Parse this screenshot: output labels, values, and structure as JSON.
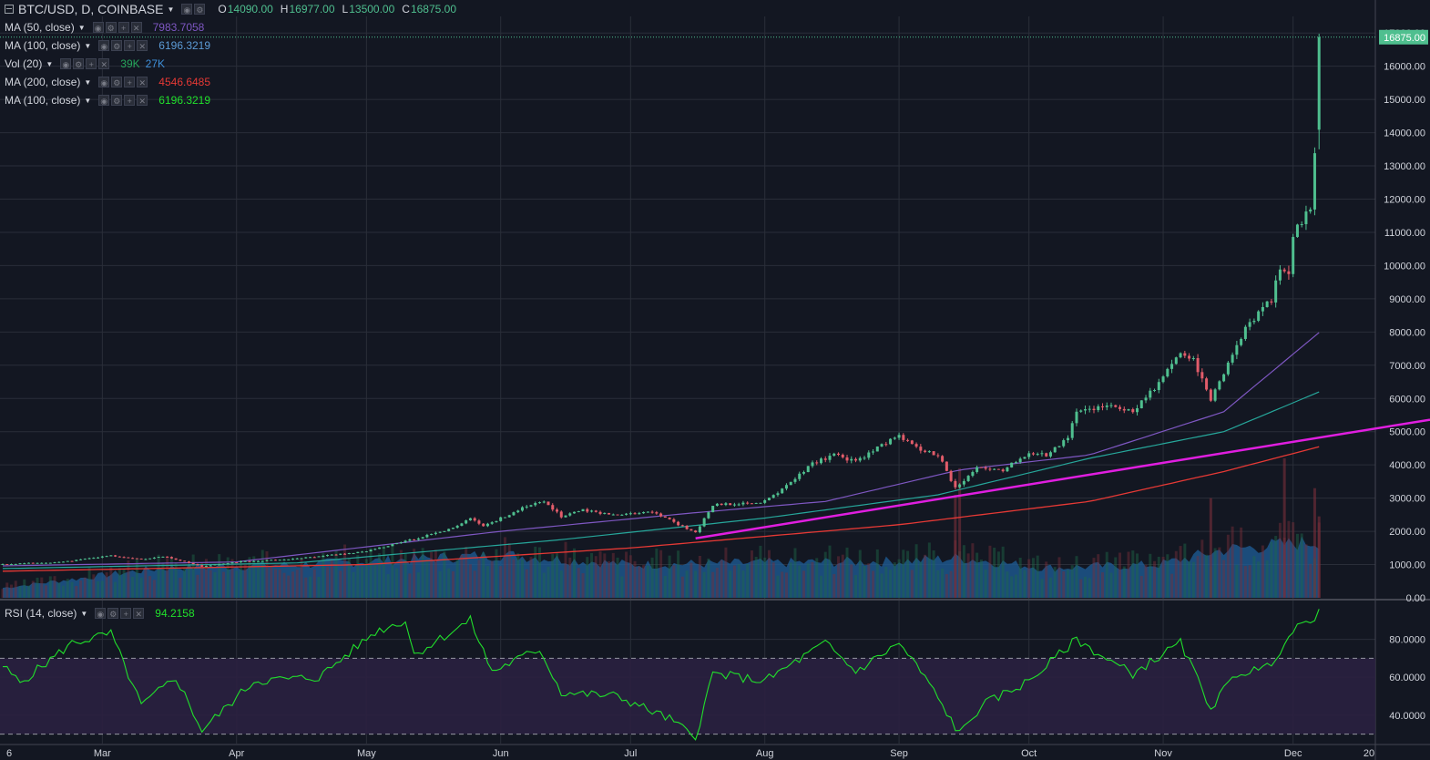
{
  "header": {
    "symbol": "BTC/USD, D, COINBASE",
    "open_label": "O",
    "open": "14090.00",
    "high_label": "H",
    "high": "16977.00",
    "low_label": "L",
    "low": "13500.00",
    "close_label": "C",
    "close": "16875.00"
  },
  "indicators": [
    {
      "label": "MA (50, close)",
      "values": [
        "7983.7058"
      ],
      "colors": [
        "#7e57c2"
      ]
    },
    {
      "label": "MA (100, close)",
      "values": [
        "6196.3219"
      ],
      "colors": [
        "#5c9bd6"
      ]
    },
    {
      "label": "Vol (20)",
      "values": [
        "39K",
        "27K"
      ],
      "colors": [
        "#26a65b",
        "#3d8ed8"
      ]
    },
    {
      "label": "MA (200, close)",
      "values": [
        "4546.6485"
      ],
      "colors": [
        "#e53935"
      ]
    },
    {
      "label": "MA (100, close)",
      "values": [
        "6196.3219"
      ],
      "colors": [
        "#21e02b"
      ]
    }
  ],
  "rsi_header": {
    "label": "RSI (14, close)",
    "value": "94.2158",
    "color": "#21e02b"
  },
  "price_axis": {
    "ticks": [
      "16000.00",
      "15000.00",
      "14000.00",
      "13000.00",
      "12000.00",
      "11000.00",
      "10000.00",
      "9000.00",
      "8000.00",
      "7000.00",
      "6000.00",
      "5000.00",
      "4000.00",
      "3000.00",
      "2000.00",
      "1000.00",
      "0.00",
      "17000.00"
    ],
    "last_price_label": "16875.00"
  },
  "rsi_axis": {
    "ticks": [
      "80.0000",
      "60.0000",
      "40.0000"
    ]
  },
  "time_axis": {
    "ticks": [
      "6",
      "Mar",
      "Apr",
      "May",
      "Jun",
      "Jul",
      "Aug",
      "Sep",
      "Oct",
      "Nov",
      "Dec",
      "20"
    ]
  },
  "colors": {
    "background": "#131722",
    "grid": "#2a2e39",
    "up": "#4fbf8f",
    "down": "#e25c6a",
    "ma50": "#7e57c2",
    "ma100": "#26a69a",
    "ma200": "#e53935",
    "trendline": "#e01ee0",
    "volume": "#1f5f99",
    "rsi_line": "#21e02b",
    "rsi_band": "#2a2040",
    "lastprice": "#4fbf8f"
  },
  "chart_data": {
    "type": "candlestick",
    "title": "BTC/USD, D, COINBASE",
    "ylim": [
      0,
      17500
    ],
    "rsi_ylim": [
      25,
      100
    ],
    "rsi_levels": [
      70,
      30
    ],
    "x_range": [
      "2017-02-06",
      "2017-12-20"
    ],
    "price_keypoints": [
      [
        "2017-02-06",
        1010
      ],
      [
        "2017-02-20",
        1080
      ],
      [
        "2017-03-03",
        1270
      ],
      [
        "2017-03-10",
        1150
      ],
      [
        "2017-03-15",
        1250
      ],
      [
        "2017-03-24",
        940
      ],
      [
        "2017-04-01",
        1080
      ],
      [
        "2017-04-15",
        1180
      ],
      [
        "2017-05-01",
        1400
      ],
      [
        "2017-05-10",
        1700
      ],
      [
        "2017-05-20",
        2050
      ],
      [
        "2017-05-25",
        2400
      ],
      [
        "2017-05-28",
        2150
      ],
      [
        "2017-06-06",
        2700
      ],
      [
        "2017-06-11",
        2900
      ],
      [
        "2017-06-15",
        2450
      ],
      [
        "2017-06-20",
        2650
      ],
      [
        "2017-06-26",
        2500
      ],
      [
        "2017-07-06",
        2600
      ],
      [
        "2017-07-16",
        1950
      ],
      [
        "2017-07-20",
        2800
      ],
      [
        "2017-07-31",
        2850
      ],
      [
        "2017-08-05",
        3250
      ],
      [
        "2017-08-12",
        4050
      ],
      [
        "2017-08-17",
        4300
      ],
      [
        "2017-08-22",
        4100
      ],
      [
        "2017-09-01",
        4900
      ],
      [
        "2017-09-05",
        4500
      ],
      [
        "2017-09-10",
        4300
      ],
      [
        "2017-09-14",
        3300
      ],
      [
        "2017-09-19",
        3900
      ],
      [
        "2017-09-25",
        3850
      ],
      [
        "2017-10-01",
        4350
      ],
      [
        "2017-10-05",
        4300
      ],
      [
        "2017-10-10",
        4800
      ],
      [
        "2017-10-12",
        5600
      ],
      [
        "2017-10-20",
        5800
      ],
      [
        "2017-10-25",
        5600
      ],
      [
        "2017-10-31",
        6450
      ],
      [
        "2017-11-05",
        7400
      ],
      [
        "2017-11-08",
        7150
      ],
      [
        "2017-11-12",
        5900
      ],
      [
        "2017-11-15",
        6800
      ],
      [
        "2017-11-20",
        8100
      ],
      [
        "2017-11-26",
        9000
      ],
      [
        "2017-11-28",
        9900
      ],
      [
        "2017-11-30",
        9700
      ],
      [
        "2017-12-01",
        10900
      ],
      [
        "2017-12-05",
        11700
      ],
      [
        "2017-12-06",
        13500
      ],
      [
        "2017-12-07",
        16875
      ]
    ],
    "ma50_keypoints": [
      [
        "2017-02-06",
        960
      ],
      [
        "2017-04-01",
        1080
      ],
      [
        "2017-06-01",
        2000
      ],
      [
        "2017-07-15",
        2550
      ],
      [
        "2017-08-15",
        2900
      ],
      [
        "2017-09-15",
        3850
      ],
      [
        "2017-10-15",
        4300
      ],
      [
        "2017-11-15",
        5600
      ],
      [
        "2017-12-07",
        7984
      ]
    ],
    "ma100_keypoints": [
      [
        "2017-02-06",
        880
      ],
      [
        "2017-04-15",
        1050
      ],
      [
        "2017-06-15",
        1750
      ],
      [
        "2017-08-01",
        2400
      ],
      [
        "2017-09-10",
        3100
      ],
      [
        "2017-10-15",
        4200
      ],
      [
        "2017-11-15",
        5000
      ],
      [
        "2017-12-07",
        6196
      ]
    ],
    "ma200_keypoints": [
      [
        "2017-02-06",
        800
      ],
      [
        "2017-05-01",
        1000
      ],
      [
        "2017-07-01",
        1500
      ],
      [
        "2017-09-01",
        2200
      ],
      [
        "2017-10-15",
        2900
      ],
      [
        "2017-11-15",
        3800
      ],
      [
        "2017-12-07",
        4547
      ]
    ],
    "trendline": [
      [
        "2017-07-16",
        1790
      ],
      [
        "2017-12-20",
        5100
      ]
    ],
    "volume_area_keypoints": [
      [
        "2017-02-06",
        300
      ],
      [
        "2017-03-15",
        900
      ],
      [
        "2017-04-15",
        1000
      ],
      [
        "2017-06-01",
        1300
      ],
      [
        "2017-07-01",
        1000
      ],
      [
        "2017-08-01",
        1050
      ],
      [
        "2017-09-01",
        1100
      ],
      [
        "2017-09-15",
        1200
      ],
      [
        "2017-10-05",
        900
      ],
      [
        "2017-10-31",
        1000
      ],
      [
        "2017-11-15",
        1450
      ],
      [
        "2017-12-07",
        1700
      ]
    ],
    "volume_spikes": [
      [
        "2017-09-15",
        3900
      ],
      [
        "2017-09-14",
        3100
      ],
      [
        "2017-11-12",
        3000
      ],
      [
        "2017-11-29",
        4200
      ],
      [
        "2017-12-06",
        3300
      ],
      [
        "2017-12-07",
        2450
      ]
    ],
    "rsi_keypoints": [
      [
        "2017-02-06",
        66
      ],
      [
        "2017-02-10",
        57
      ],
      [
        "2017-02-22",
        78
      ],
      [
        "2017-03-03",
        83
      ],
      [
        "2017-03-10",
        45
      ],
      [
        "2017-03-18",
        60
      ],
      [
        "2017-03-24",
        32
      ],
      [
        "2017-04-05",
        58
      ],
      [
        "2017-04-20",
        60
      ],
      [
        "2017-05-03",
        84
      ],
      [
        "2017-05-10",
        90
      ],
      [
        "2017-05-12",
        72
      ],
      [
        "2017-05-25",
        90
      ],
      [
        "2017-05-30",
        63
      ],
      [
        "2017-06-10",
        75
      ],
      [
        "2017-06-15",
        52
      ],
      [
        "2017-06-28",
        50
      ],
      [
        "2017-07-10",
        38
      ],
      [
        "2017-07-16",
        28
      ],
      [
        "2017-07-20",
        62
      ],
      [
        "2017-08-01",
        58
      ],
      [
        "2017-08-15",
        78
      ],
      [
        "2017-08-22",
        63
      ],
      [
        "2017-09-01",
        78
      ],
      [
        "2017-09-07",
        60
      ],
      [
        "2017-09-15",
        30
      ],
      [
        "2017-09-20",
        45
      ],
      [
        "2017-10-01",
        58
      ],
      [
        "2017-10-12",
        80
      ],
      [
        "2017-10-20",
        68
      ],
      [
        "2017-10-25",
        62
      ],
      [
        "2017-11-05",
        78
      ],
      [
        "2017-11-12",
        44
      ],
      [
        "2017-11-18",
        62
      ],
      [
        "2017-11-25",
        65
      ],
      [
        "2017-12-01",
        84
      ],
      [
        "2017-12-07",
        94
      ]
    ]
  }
}
